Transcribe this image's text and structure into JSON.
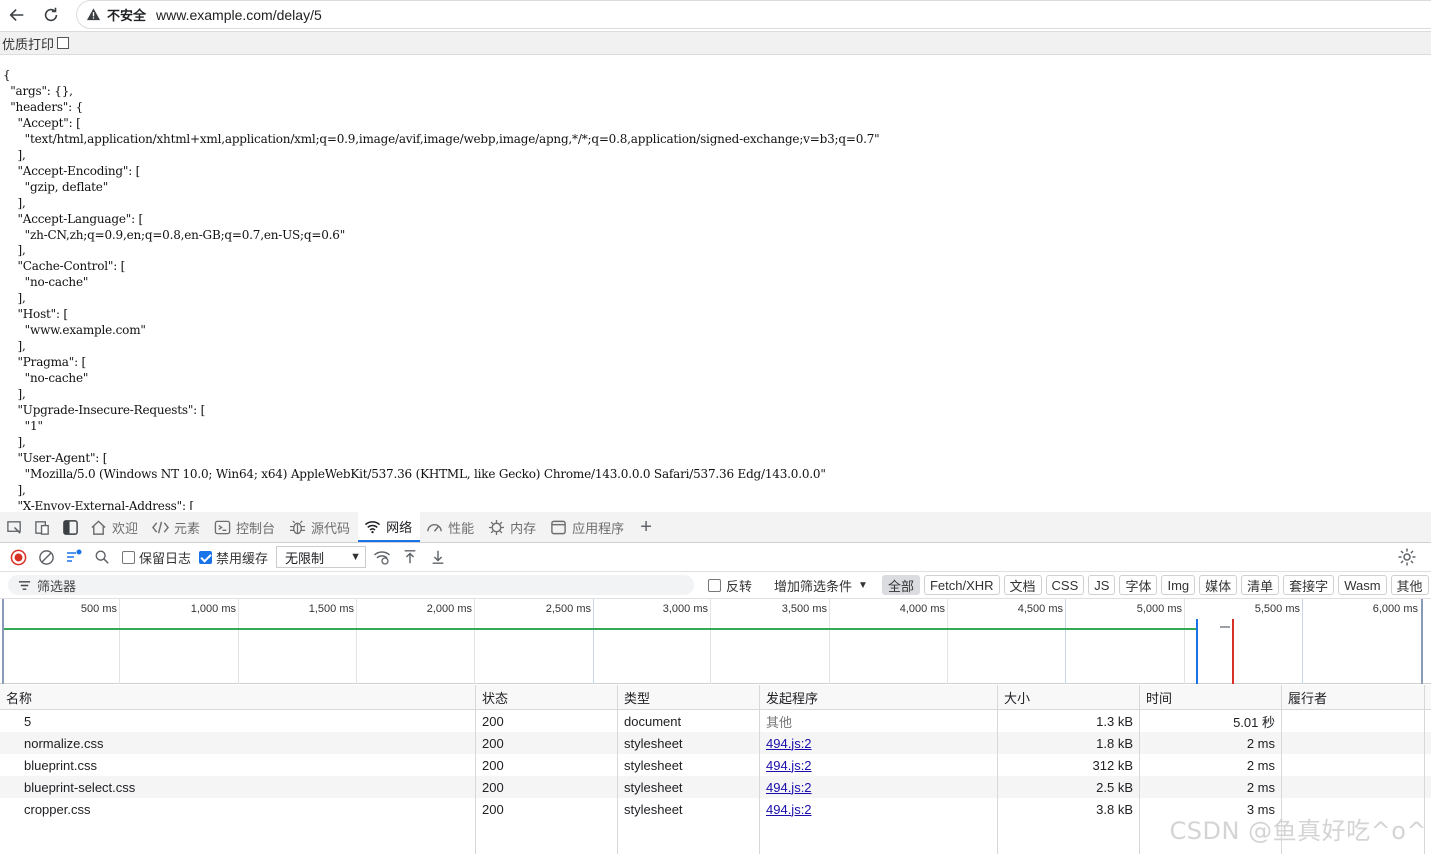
{
  "browser": {
    "back_icon": "arrow-left-icon",
    "reload_icon": "reload-icon",
    "security_label": "不安全",
    "url": "www.example.com/delay/5"
  },
  "printbar": {
    "label": "优质打印"
  },
  "page": {
    "json_text": "{\n  \"args\": {},\n  \"headers\": {\n    \"Accept\": [\n      \"text/html,application/xhtml+xml,application/xml;q=0.9,image/avif,image/webp,image/apng,*/*;q=0.8,application/signed-exchange;v=b3;q=0.7\"\n    ],\n    \"Accept-Encoding\": [\n      \"gzip, deflate\"\n    ],\n    \"Accept-Language\": [\n      \"zh-CN,zh;q=0.9,en;q=0.8,en-GB;q=0.7,en-US;q=0.6\"\n    ],\n    \"Cache-Control\": [\n      \"no-cache\"\n    ],\n    \"Host\": [\n      \"www.example.com\"\n    ],\n    \"Pragma\": [\n      \"no-cache\"\n    ],\n    \"Upgrade-Insecure-Requests\": [\n      \"1\"\n    ],\n    \"User-Agent\": [\n      \"Mozilla/5.0 (Windows NT 10.0; Win64; x64) AppleWebKit/537.36 (KHTML, like Gecko) Chrome/143.0.0.0 Safari/537.36 Edg/143.0.0.0\"\n    ],\n    \"X-Envoy-External-Address\": ["
  },
  "devtools": {
    "tabs": [
      {
        "label": "欢迎",
        "icon": "home-icon"
      },
      {
        "label": "元素",
        "icon": "code-icon"
      },
      {
        "label": "控制台",
        "icon": "console-icon"
      },
      {
        "label": "源代码",
        "icon": "bug-icon"
      },
      {
        "label": "网络",
        "icon": "wifi-icon"
      },
      {
        "label": "性能",
        "icon": "performance-icon"
      },
      {
        "label": "内存",
        "icon": "memory-icon"
      },
      {
        "label": "应用程序",
        "icon": "application-icon"
      }
    ],
    "toolbar": {
      "preserve_log": "保留日志",
      "disable_cache": "禁用缓存",
      "throttle": "无限制"
    },
    "filter": {
      "placeholder": "筛选器",
      "invert": "反转",
      "more_filters": "增加筛选条件",
      "chips": [
        "全部",
        "Fetch/XHR",
        "文档",
        "CSS",
        "JS",
        "字体",
        "Img",
        "媒体",
        "清单",
        "套接字",
        "Wasm",
        "其他"
      ]
    },
    "overview": {
      "ticks": [
        "500 ms",
        "1,000 ms",
        "1,500 ms",
        "2,000 ms",
        "2,500 ms",
        "3,000 ms",
        "3,500 ms",
        "4,000 ms",
        "4,500 ms",
        "5,000 ms",
        "5,500 ms",
        "6,000 ms"
      ]
    },
    "table": {
      "headers": {
        "name": "名称",
        "status": "状态",
        "type": "类型",
        "initiator": "发起程序",
        "size": "大小",
        "time": "时间",
        "fulfilled": "履行者"
      },
      "rows": [
        {
          "name": "5",
          "status": "200",
          "type": "document",
          "initiator": "其他",
          "size": "1.3 kB",
          "time": "5.01 秒"
        },
        {
          "name": "normalize.css",
          "status": "200",
          "type": "stylesheet",
          "initiator": "494.js:2",
          "size": "1.8 kB",
          "time": "2 ms"
        },
        {
          "name": "blueprint.css",
          "status": "200",
          "type": "stylesheet",
          "initiator": "494.js:2",
          "size": "312 kB",
          "time": "2 ms"
        },
        {
          "name": "blueprint-select.css",
          "status": "200",
          "type": "stylesheet",
          "initiator": "494.js:2",
          "size": "2.5 kB",
          "time": "2 ms"
        },
        {
          "name": "cropper.css",
          "status": "200",
          "type": "stylesheet",
          "initiator": "494.js:2",
          "size": "3.8 kB",
          "time": "3 ms"
        }
      ]
    }
  },
  "watermark": "CSDN @鱼真好吃^o^"
}
